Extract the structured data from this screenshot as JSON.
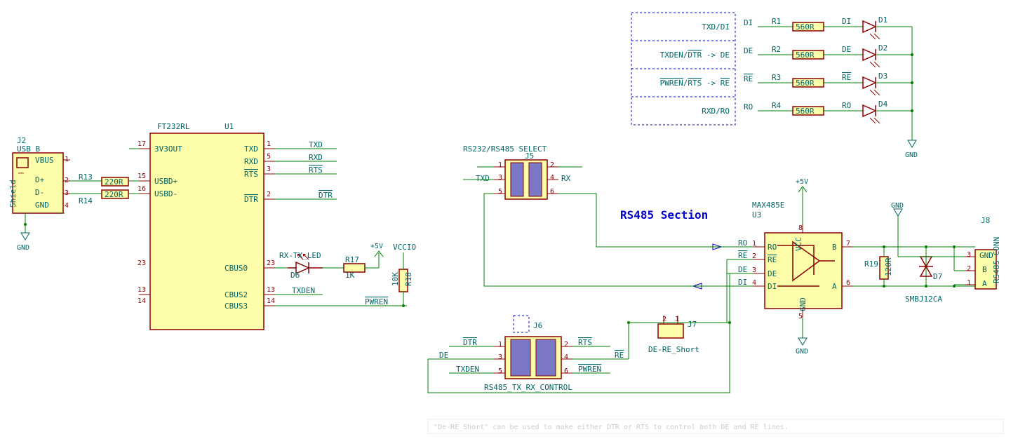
{
  "section_title": "RS485 Section",
  "usb_conn": {
    "ref": "J2",
    "val": "USB_B",
    "pins": [
      "VBUS",
      "D+",
      "D-",
      "GND",
      "Shield"
    ]
  },
  "gnd_label": "GND",
  "r13": {
    "ref": "R13",
    "val": "220R"
  },
  "r14": {
    "ref": "R14",
    "val": "220R"
  },
  "u1": {
    "ref": "U1",
    "val": "FT232RL",
    "left": {
      "p17": "3V3OUT",
      "p15": "USBD+",
      "p16": "USBD-",
      "p23": "CBUS0",
      "p13": "CBUS2",
      "p14": "CBUS3"
    },
    "right": {
      "p1": "TXD",
      "p5": "RXD",
      "p3": "RTS",
      "p2": "DTR"
    }
  },
  "nets_u1": {
    "txd": "TXD",
    "rxd": "RXD",
    "rts": "RTS",
    "dtr": "DTR",
    "txden": "TXDEN",
    "pwren": "PWREN",
    "vccio": "VCCIO",
    "p5v": "+5V"
  },
  "d6": {
    "ref": "D6",
    "sig": "RX-TX_LED"
  },
  "r17": {
    "ref": "R17",
    "val": "1K"
  },
  "r18": {
    "ref": "R18",
    "val": "10K"
  },
  "j5": {
    "ref": "J5",
    "title": "RS232/RS485 SELECT",
    "labels": [
      "TXD",
      "RX"
    ]
  },
  "j6": {
    "ref": "J6",
    "title": "RS485_TX_RX_CONTROL",
    "l1": "DTR",
    "r1": "RTS",
    "l2": "DE",
    "r2": "RE",
    "l3": "TXDEN",
    "r3": "PWREN"
  },
  "j7": {
    "ref": "J7",
    "title": "DE-RE_Short"
  },
  "u3": {
    "ref": "U3",
    "val": "MAX485E",
    "pins": {
      "ro": "RO",
      "re": "RE",
      "de": "DE",
      "di": "DI",
      "vcc": "VCC",
      "gnd": "GND",
      "a": "A",
      "b": "B"
    }
  },
  "r19": {
    "ref": "R19",
    "val": "120R"
  },
  "d7": {
    "ref": "D7",
    "val": "SMBJ12CA"
  },
  "j8": {
    "ref": "J8",
    "title": "RS485 CONN",
    "pins": [
      "GND",
      "B",
      "A"
    ]
  },
  "map_box": {
    "row1": "TXD/DI",
    "row2": "TXDEN/DTR -> DE",
    "row3": "PWREN/RTS  -> RE",
    "row4": "RXD/RO"
  },
  "led_rows": [
    {
      "net": "DI",
      "r_ref": "R1",
      "r_val": "560R",
      "d_ref": "D1"
    },
    {
      "net": "DE",
      "r_ref": "R2",
      "r_val": "560R",
      "d_ref": "D2"
    },
    {
      "net": "RE",
      "r_ref": "R3",
      "r_val": "560R",
      "d_ref": "D3"
    },
    {
      "net": "RO",
      "r_ref": "R4",
      "r_val": "560R",
      "d_ref": "D4"
    }
  ],
  "u3_nets": {
    "ro": "RO",
    "re": "RE",
    "de": "DE",
    "di": "DI",
    "p5v": "+5V",
    "gnd": "GND"
  },
  "note": "\"De-RE_Short\" can be used to make either DTR or RTS to control both DE and RE lines."
}
